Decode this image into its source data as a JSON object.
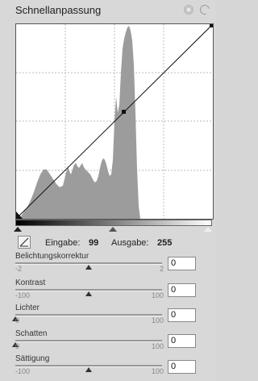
{
  "panel": {
    "title": "Schnellanpassung",
    "header_icons": [
      "settings-icon",
      "reset-icon"
    ]
  },
  "curve": {
    "input_label": "Eingabe:",
    "input_value": "99",
    "output_label": "Ausgabe:",
    "output_value": "255"
  },
  "sliders": [
    {
      "label": "Belichtungskorrektur",
      "min": "-2",
      "max": "2",
      "value": "0",
      "position": 0.5
    },
    {
      "label": "Kontrast",
      "min": "-100",
      "max": "100",
      "value": "0",
      "position": 0.5
    },
    {
      "label": "Lichter",
      "min": "0",
      "max": "100",
      "value": "0",
      "position": 0.0
    },
    {
      "label": "Schatten",
      "min": "0",
      "max": "100",
      "value": "0",
      "position": 0.0
    },
    {
      "label": "Sättigung",
      "min": "-100",
      "max": "100",
      "value": "0",
      "position": 0.5
    }
  ],
  "colors": {
    "panel_bg": "#d8d8d8",
    "histogram": "#9c9c9c",
    "grid": "#bbbbbb"
  }
}
